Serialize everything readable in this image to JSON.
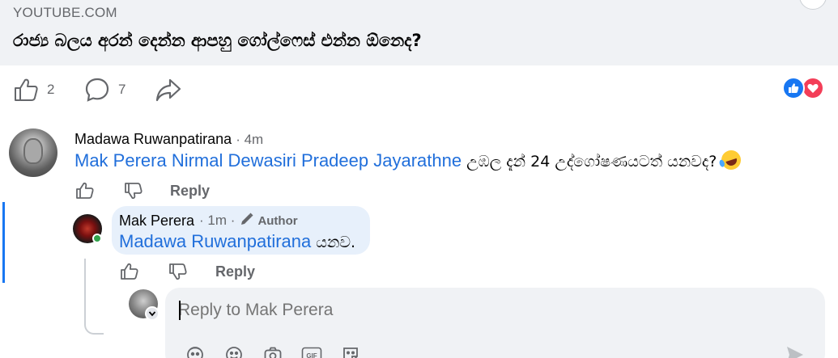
{
  "link_preview": {
    "domain": "YOUTUBE.COM",
    "headline": "රාජ්‍ය බලය අරන් දෙන්න ආපහු ගෝල්ෆෙස් එන්න ඕනෙද?"
  },
  "post_actions": {
    "like_count": "2",
    "comment_count": "7",
    "icons": [
      "like-icon",
      "comment-icon",
      "share-icon"
    ],
    "reactions": [
      "like",
      "love"
    ]
  },
  "comments": [
    {
      "author": "Madawa Ruwanpatirana",
      "time": "· 4m",
      "mentions": "Mak Perera Nirmal Dewasiri Pradeep Jayarathne",
      "text": " උඹල දැන් 24 උද්ගෝෂණයටත් යනවද? ",
      "emoji": "rolling-on-floor-laughing",
      "reply_label": "Reply"
    },
    {
      "author": "Mak Perera",
      "time": "· 1m ·",
      "badge": "Author",
      "mentions": "Madawa Ruwanpatirana",
      "text": " යනව.",
      "reply_label": "Reply",
      "online": true
    }
  ],
  "composer": {
    "placeholder": "Reply to Mak Perera",
    "tools": [
      "avatar-sticker-icon",
      "emoji-icon",
      "camera-icon",
      "gif-icon",
      "sticker-icon"
    ]
  },
  "colors": {
    "link": "#216fdb",
    "thread_accent": "#1877f2",
    "reply_bubble": "#e7f0fb",
    "background_grey": "#f0f2f5"
  }
}
